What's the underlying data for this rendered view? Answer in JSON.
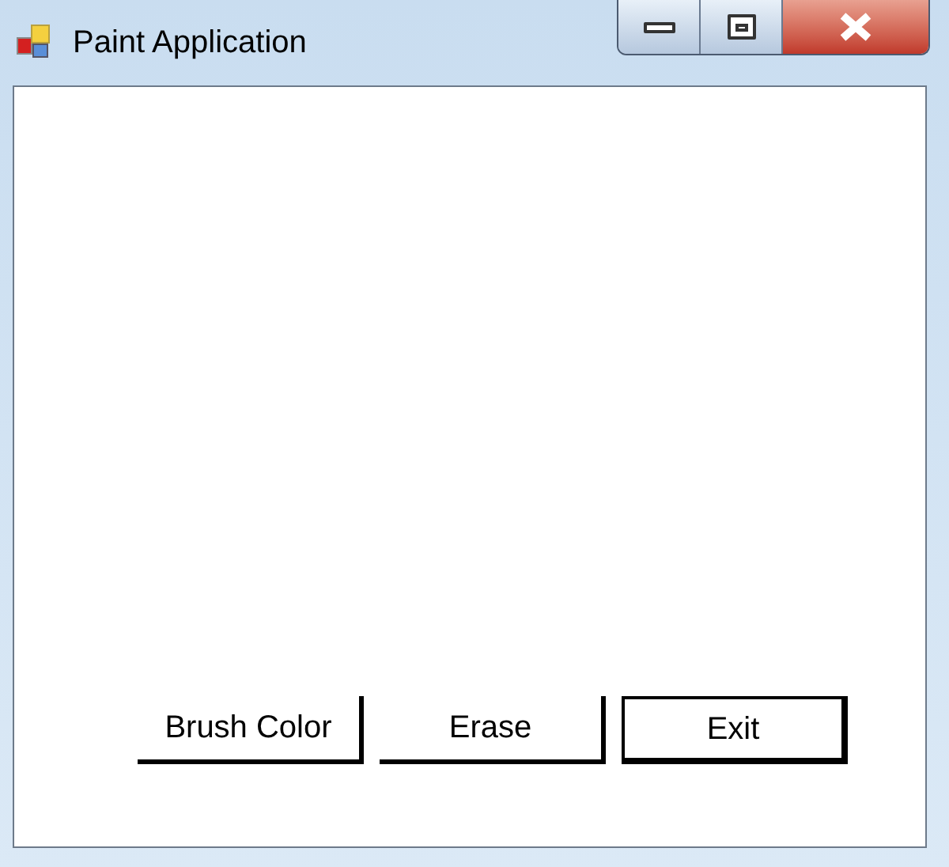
{
  "window": {
    "title": "Paint Application"
  },
  "buttons": [
    {
      "label": "Brush Color",
      "default": false
    },
    {
      "label": "Erase",
      "default": false
    },
    {
      "label": "Exit",
      "default": true
    }
  ]
}
